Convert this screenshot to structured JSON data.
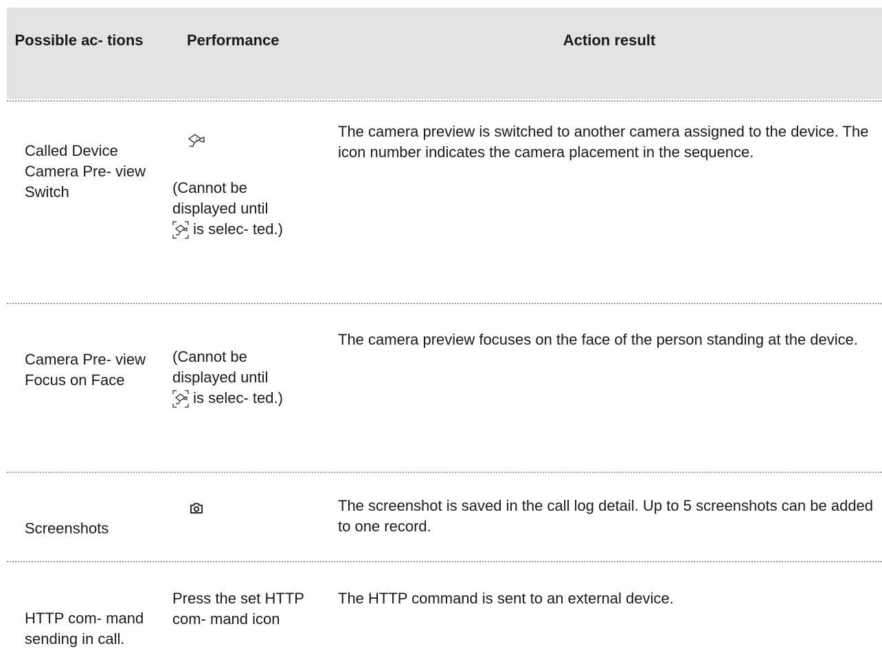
{
  "table": {
    "headers": {
      "col1": "Possible ac- tions",
      "col2": "Performance",
      "col3": "Action result"
    },
    "rows": [
      {
        "action": "Called Device Camera Pre- view Switch",
        "performance_icon": "camera-switch-icon",
        "performance_note_prefix": "(Cannot be displayed until",
        "performance_note_icon": "camera-preview-icon",
        "performance_note_suffix": "is selec- ted.)",
        "result": "The camera preview is switched to another camera assigned to the device. The icon number indicates the camera placement in the sequence."
      },
      {
        "action": "Camera Pre- view Focus on Face",
        "performance_note_prefix": "(Cannot be displayed until",
        "performance_note_icon": "camera-preview-icon",
        "performance_note_suffix": "is selec- ted.)",
        "result": "The camera preview focuses on the face of the person standing at the device."
      },
      {
        "action": "Screenshots",
        "performance_icon": "screenshot-camera-icon",
        "result": "The screenshot is saved in the call log detail. Up to 5 screenshots can be added to one record."
      },
      {
        "action": "HTTP com- mand sending in call.",
        "performance": "Press the set HTTP com- mand icon",
        "result": "The HTTP command is sent to an external device."
      }
    ]
  }
}
